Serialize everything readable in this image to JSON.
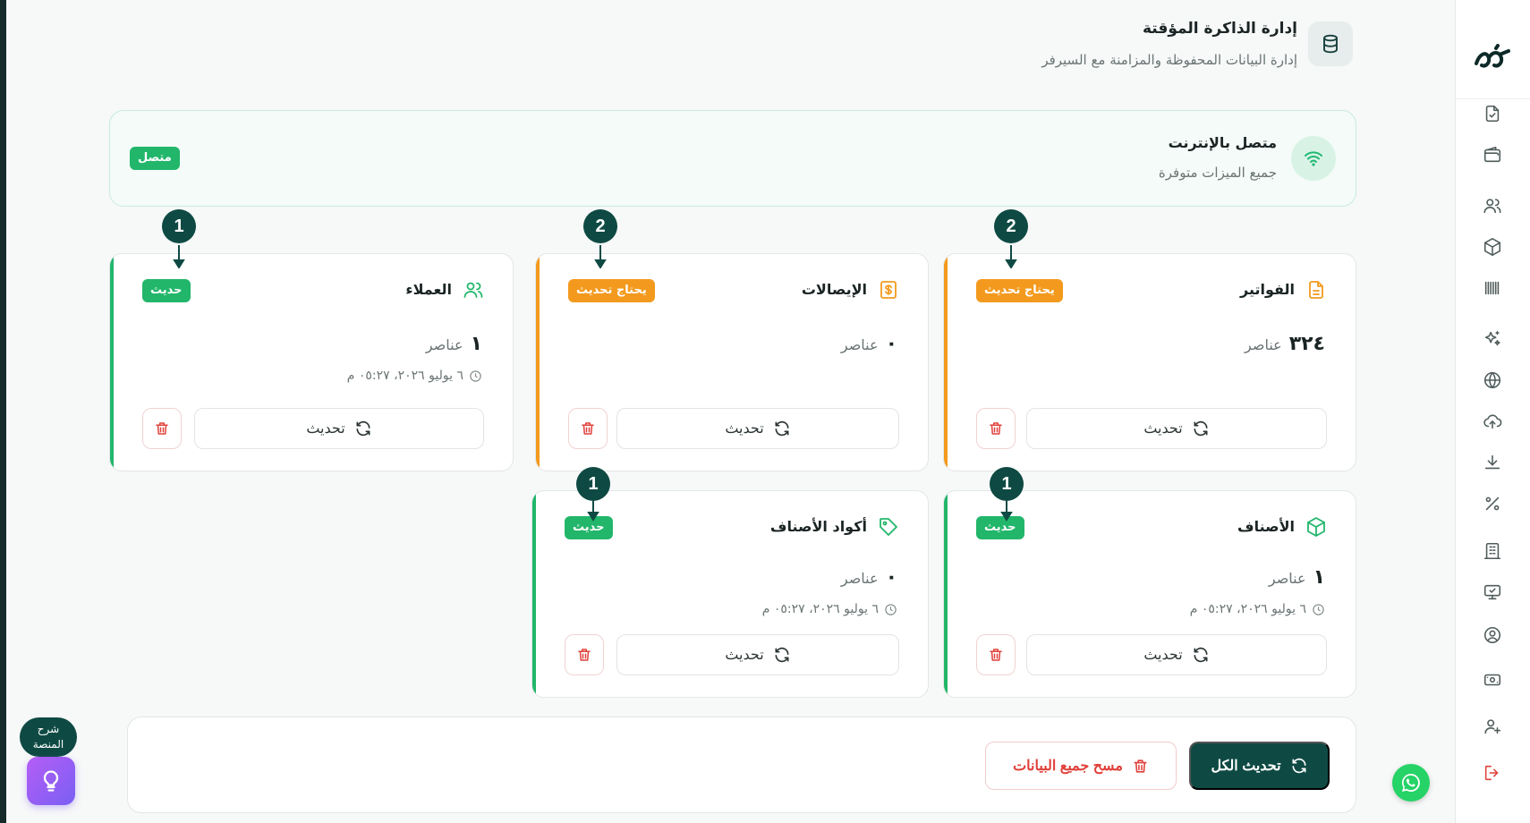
{
  "header": {
    "title": "إدارة الذاكرة المؤقتة",
    "subtitle": "إدارة البيانات المحفوظة والمزامنة مع السيرفر"
  },
  "connection": {
    "title": "متصل بالإنترنت",
    "subtitle": "جميع الميزات متوفرة",
    "badge": "متصل"
  },
  "cards": [
    {
      "id": "invoices",
      "title": "الفواتير",
      "icon": "file-text-icon",
      "status": "يحتاج تحديث",
      "status_color": "#f39a1e",
      "count": "٣٢٤",
      "count_label": "عناصر",
      "timestamp": "",
      "refresh_label": "تحديث",
      "marker": "2"
    },
    {
      "id": "receipts",
      "title": "الإيصالات",
      "icon": "receipt-icon",
      "status": "يحتاج تحديث",
      "status_color": "#f39a1e",
      "count": "٠",
      "count_label": "عناصر",
      "timestamp": "",
      "refresh_label": "تحديث",
      "marker": "2"
    },
    {
      "id": "customers",
      "title": "العملاء",
      "icon": "users-icon",
      "status": "حديث",
      "status_color": "#22b66b",
      "count": "١",
      "count_label": "عناصر",
      "timestamp": "٦ يوليو ٢٠٢٦، ٠٥:٢٧ م",
      "refresh_label": "تحديث",
      "marker": "1"
    },
    {
      "id": "products",
      "title": "الأصناف",
      "icon": "package-icon",
      "status": "حديث",
      "status_color": "#22b66b",
      "count": "١",
      "count_label": "عناصر",
      "timestamp": "٦ يوليو ٢٠٢٦، ٠٥:٢٧ م",
      "refresh_label": "تحديث",
      "marker": "1"
    },
    {
      "id": "product_codes",
      "title": "أكواد الأصناف",
      "icon": "tag-icon",
      "status": "حديث",
      "status_color": "#22b66b",
      "count": "٠",
      "count_label": "عناصر",
      "timestamp": "٦ يوليو ٢٠٢٦، ٠٥:٢٧ م",
      "refresh_label": "تحديث",
      "marker": "1"
    }
  ],
  "actions": {
    "refresh_all": "تحديث الكل",
    "clear_all": "مسح جميع البيانات"
  },
  "tour": {
    "label": "شرح المنصة"
  },
  "colors": {
    "brand": "#0e4a43",
    "success": "#22b66b",
    "warning": "#f39a1e",
    "danger": "#e0403a"
  },
  "sidebar_icons": [
    "file-check-icon",
    "wallet-icon",
    "users-icon",
    "package-icon",
    "barcode-icon",
    "sparkles-icon",
    "globe-icon",
    "cloud-upload-icon",
    "download-icon",
    "percent-icon",
    "building-icon",
    "monitor-icon",
    "user-circle-icon",
    "cash-icon",
    "user-plus-icon",
    "logout-icon"
  ]
}
